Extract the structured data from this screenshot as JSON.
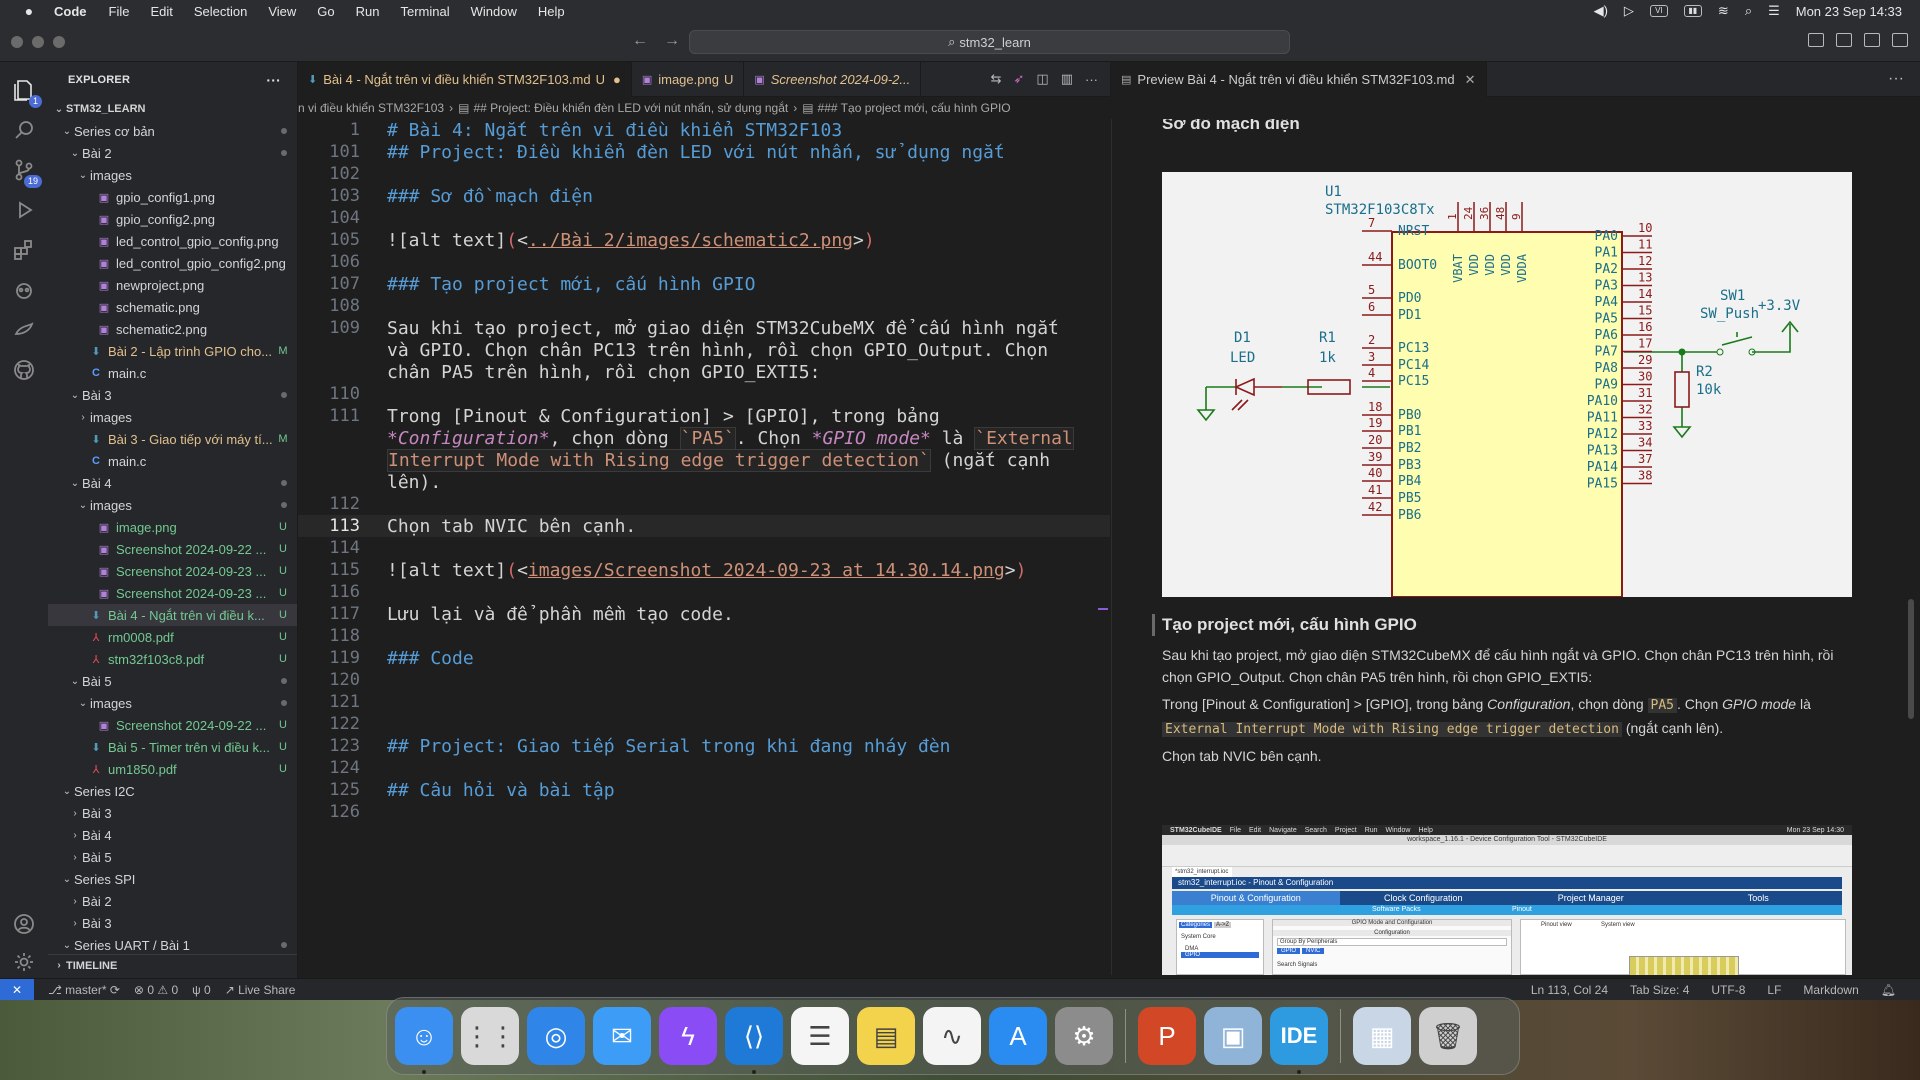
{
  "menubar": {
    "app": "Code",
    "items": [
      "File",
      "Edit",
      "Selection",
      "View",
      "Go",
      "Run",
      "Terminal",
      "Window",
      "Help"
    ],
    "clock": "Mon 23 Sep  14:33",
    "input_source": "VI"
  },
  "titlebar": {
    "search": "stm32_learn"
  },
  "activity": {
    "badge_explorer": "1",
    "badge_scm": "19"
  },
  "explorer": {
    "title": "EXPLORER",
    "root": "STM32_LEARN",
    "rows": [
      {
        "indent": 1,
        "kind": "folder-open",
        "name": "Series cơ bản",
        "status": "dot"
      },
      {
        "indent": 2,
        "kind": "folder-open",
        "name": "Bài 2",
        "status": "dot"
      },
      {
        "indent": 3,
        "kind": "folder-open",
        "name": "images",
        "status": ""
      },
      {
        "indent": 4,
        "kind": "img",
        "name": "gpio_config1.png",
        "status": ""
      },
      {
        "indent": 4,
        "kind": "img",
        "name": "gpio_config2.png",
        "status": ""
      },
      {
        "indent": 4,
        "kind": "img",
        "name": "led_control_gpio_config.png",
        "status": ""
      },
      {
        "indent": 4,
        "kind": "img",
        "name": "led_control_gpio_config2.png",
        "status": ""
      },
      {
        "indent": 4,
        "kind": "img",
        "name": "newproject.png",
        "status": ""
      },
      {
        "indent": 4,
        "kind": "img",
        "name": "schematic.png",
        "status": ""
      },
      {
        "indent": 4,
        "kind": "img",
        "name": "schematic2.png",
        "status": ""
      },
      {
        "indent": 3,
        "kind": "md",
        "name": "Bài 2 - Lập trình GPIO cho...",
        "status": "M"
      },
      {
        "indent": 3,
        "kind": "c",
        "name": "main.c",
        "status": ""
      },
      {
        "indent": 2,
        "kind": "folder-open",
        "name": "Bài 3",
        "status": "dot"
      },
      {
        "indent": 3,
        "kind": "folder",
        "name": "images",
        "status": ""
      },
      {
        "indent": 3,
        "kind": "md",
        "name": "Bài 3 - Giao tiếp với máy tí...",
        "status": "M"
      },
      {
        "indent": 3,
        "kind": "c",
        "name": "main.c",
        "status": ""
      },
      {
        "indent": 2,
        "kind": "folder-open",
        "name": "Bài 4",
        "status": "dot"
      },
      {
        "indent": 3,
        "kind": "folder-open",
        "name": "images",
        "status": "dot"
      },
      {
        "indent": 4,
        "kind": "img",
        "name": "image.png",
        "status": "U"
      },
      {
        "indent": 4,
        "kind": "img",
        "name": "Screenshot 2024-09-22 ...",
        "status": "U"
      },
      {
        "indent": 4,
        "kind": "img",
        "name": "Screenshot 2024-09-23 ...",
        "status": "U"
      },
      {
        "indent": 4,
        "kind": "img",
        "name": "Screenshot 2024-09-23 ...",
        "status": "U"
      },
      {
        "indent": 3,
        "kind": "md",
        "name": "Bài 4 - Ngắt trên vi điều k...",
        "status": "U",
        "selected": true
      },
      {
        "indent": 3,
        "kind": "pdf",
        "name": "rm0008.pdf",
        "status": "U"
      },
      {
        "indent": 3,
        "kind": "pdf",
        "name": "stm32f103c8.pdf",
        "status": "U"
      },
      {
        "indent": 2,
        "kind": "folder-open",
        "name": "Bài 5",
        "status": "dot"
      },
      {
        "indent": 3,
        "kind": "folder-open",
        "name": "images",
        "status": "dot"
      },
      {
        "indent": 4,
        "kind": "img",
        "name": "Screenshot 2024-09-22 ...",
        "status": "U"
      },
      {
        "indent": 3,
        "kind": "md",
        "name": "Bài 5 - Timer trên vi điều k...",
        "status": "U"
      },
      {
        "indent": 3,
        "kind": "pdf",
        "name": "um1850.pdf",
        "status": "U"
      },
      {
        "indent": 1,
        "kind": "folder-open",
        "name": "Series I2C",
        "status": ""
      },
      {
        "indent": 2,
        "kind": "folder",
        "name": "Bài 3",
        "status": ""
      },
      {
        "indent": 2,
        "kind": "folder",
        "name": "Bài 4",
        "status": ""
      },
      {
        "indent": 2,
        "kind": "folder",
        "name": "Bài 5",
        "status": ""
      },
      {
        "indent": 1,
        "kind": "folder-open",
        "name": "Series SPI",
        "status": ""
      },
      {
        "indent": 2,
        "kind": "folder",
        "name": "Bài 2",
        "status": ""
      },
      {
        "indent": 2,
        "kind": "folder",
        "name": "Bài 3",
        "status": ""
      },
      {
        "indent": 1,
        "kind": "folder-open",
        "name": "Series UART / Bài 1",
        "status": "dot"
      }
    ],
    "timeline": "TIMELINE"
  },
  "tabs": {
    "left": [
      {
        "label": "Bài 4 - Ngắt trên vi điều khiển STM32F103.md",
        "status": "U",
        "active": true
      },
      {
        "label": "image.png",
        "status": "U",
        "active": false
      },
      {
        "label": "Screenshot 2024-09-2...",
        "status": "",
        "active": false
      }
    ],
    "right": {
      "label": "Preview Bài 4 - Ngắt trên vi điều khiển STM32F103.md"
    }
  },
  "breadcrumb": {
    "parts": [
      "n vi điều khiển STM32F103",
      "## Project: Điều khiển đèn LED với nút nhấn, sử dụng ngắt",
      "### Tạo project mới, cấu hình GPIO"
    ]
  },
  "editor": {
    "current_line": "113",
    "lines": [
      {
        "n": "1",
        "segs": [
          [
            "h",
            "# Bài 4: Ngắt trên vi điều khiển STM32F103"
          ]
        ]
      },
      {
        "n": "101",
        "segs": [
          [
            "h",
            "## Project: Điều khiển đèn LED với nút nhấn, sử dụng ngắt"
          ]
        ]
      },
      {
        "n": "102",
        "segs": []
      },
      {
        "n": "103",
        "segs": [
          [
            "h",
            "### Sơ đồ mạch điện"
          ]
        ]
      },
      {
        "n": "104",
        "segs": []
      },
      {
        "n": "105",
        "segs": [
          [
            "t",
            "![alt text]"
          ],
          [
            "br",
            "("
          ],
          [
            "t",
            "<"
          ],
          [
            "url",
            "../Bài 2/images/schematic2.png"
          ],
          [
            "t",
            ">"
          ],
          [
            "br",
            ")"
          ]
        ]
      },
      {
        "n": "106",
        "segs": []
      },
      {
        "n": "107",
        "segs": [
          [
            "h",
            "### Tạo project mới, cấu hình GPIO"
          ]
        ]
      },
      {
        "n": "108",
        "segs": []
      },
      {
        "n": "109",
        "segs": [
          [
            "t",
            "Sau khi tạo project, mở giao diện STM32CubeMX để cấu hình ngắt"
          ]
        ]
      },
      {
        "n": "",
        "segs": [
          [
            "t",
            "và GPIO. Chọn chân PC13 trên hình, rồi chọn GPIO_Output. Chọn"
          ]
        ]
      },
      {
        "n": "",
        "segs": [
          [
            "t",
            "chân PA5 trên hình, rồi chọn GPIO_EXTI5:"
          ]
        ]
      },
      {
        "n": "110",
        "segs": []
      },
      {
        "n": "111",
        "segs": [
          [
            "t",
            "Trong [Pinout & Configuration] > [GPIO], trong bảng"
          ]
        ]
      },
      {
        "n": "",
        "segs": [
          [
            "em",
            "*Configuration*"
          ],
          [
            "t",
            ", chọn dòng "
          ],
          [
            "cd",
            "`PA5`"
          ],
          [
            "t",
            ". Chọn "
          ],
          [
            "em",
            "*GPIO mode*"
          ],
          [
            "t",
            " là "
          ],
          [
            "cd",
            "`External"
          ]
        ]
      },
      {
        "n": "",
        "segs": [
          [
            "cd",
            "Interrupt Mode with Rising edge trigger detection`"
          ],
          [
            "t",
            " (ngắt cạnh"
          ]
        ]
      },
      {
        "n": "",
        "segs": [
          [
            "t",
            "lên)."
          ]
        ]
      },
      {
        "n": "112",
        "segs": []
      },
      {
        "n": "113",
        "segs": [
          [
            "t",
            "Chọn tab NVIC bên cạnh."
          ]
        ]
      },
      {
        "n": "114",
        "segs": []
      },
      {
        "n": "115",
        "segs": [
          [
            "t",
            "![alt text]"
          ],
          [
            "br",
            "("
          ],
          [
            "t",
            "<"
          ],
          [
            "url",
            "images/Screenshot 2024-09-23 at 14.30.14.png"
          ],
          [
            "t",
            ">"
          ],
          [
            "br",
            ")"
          ]
        ]
      },
      {
        "n": "116",
        "segs": []
      },
      {
        "n": "117",
        "segs": [
          [
            "t",
            "Lưu lại và để phần mềm tạo code."
          ]
        ]
      },
      {
        "n": "118",
        "segs": []
      },
      {
        "n": "119",
        "segs": [
          [
            "h",
            "### Code"
          ]
        ]
      },
      {
        "n": "120",
        "segs": []
      },
      {
        "n": "121",
        "segs": []
      },
      {
        "n": "122",
        "segs": []
      },
      {
        "n": "123",
        "segs": [
          [
            "h",
            "## Project: Giao tiếp Serial trong khi đang nháy đèn"
          ]
        ]
      },
      {
        "n": "124",
        "segs": []
      },
      {
        "n": "125",
        "segs": [
          [
            "h",
            "## Câu hỏi và bài tập"
          ]
        ]
      },
      {
        "n": "126",
        "segs": []
      }
    ]
  },
  "preview": {
    "h_schematic": "Sơ đồ mạch điện",
    "h_project": "Tạo project mới, cấu hình GPIO",
    "p1": "Sau khi tạo project, mở giao diện STM32CubeMX để cấu hình ngắt và GPIO. Chọn chân PC13 trên hình, rồi chọn GPIO_Output. Chọn chân PA5 trên hình, rồi chọn GPIO_EXTI5:",
    "p2_a": "Trong [Pinout & Configuration] > [GPIO], trong bảng ",
    "p2_em1": "Configuration",
    "p2_b": ", chọn dòng ",
    "p2_code1": "PA5",
    "p2_c": ". Chọn ",
    "p2_em2": "GPIO mode",
    "p2_d": " là ",
    "p2_code2": "External Interrupt Mode with Rising edge trigger detection",
    "p2_e": " (ngắt cạnh lên).",
    "p3": "Chọn tab NVIC bên cạnh.",
    "schematic": {
      "u1": "U1",
      "part": "STM32F103C8Tx",
      "left_pins": [
        [
          "7",
          "NRST"
        ],
        [
          "44",
          "BOOT0"
        ],
        [
          "5",
          "PD0"
        ],
        [
          "6",
          "PD1"
        ],
        [
          "2",
          "PC13"
        ],
        [
          "3",
          "PC14"
        ],
        [
          "4",
          "PC15"
        ],
        [
          "18",
          "PB0"
        ],
        [
          "19",
          "PB1"
        ],
        [
          "20",
          "PB2"
        ],
        [
          "39",
          "PB3"
        ],
        [
          "40",
          "PB4"
        ],
        [
          "41",
          "PB5"
        ],
        [
          "42",
          "PB6"
        ]
      ],
      "right_pins": [
        [
          "10",
          "PA0"
        ],
        [
          "11",
          "PA1"
        ],
        [
          "12",
          "PA2"
        ],
        [
          "13",
          "PA3"
        ],
        [
          "14",
          "PA4"
        ],
        [
          "15",
          "PA5"
        ],
        [
          "16",
          "PA6"
        ],
        [
          "17",
          "PA7"
        ],
        [
          "29",
          "PA8"
        ],
        [
          "30",
          "PA9"
        ],
        [
          "31",
          "PA10"
        ],
        [
          "32",
          "PA11"
        ],
        [
          "33",
          "PA12"
        ],
        [
          "34",
          "PA13"
        ],
        [
          "37",
          "PA14"
        ],
        [
          "38",
          "PA15"
        ]
      ],
      "top_pins": [
        [
          "1",
          "VBAT"
        ],
        [
          "24",
          "VDD"
        ],
        [
          "36",
          "VDD"
        ],
        [
          "48",
          "VDD"
        ],
        [
          "9",
          "VDDA"
        ]
      ],
      "d1": "D1",
      "led": "LED",
      "r1": "R1",
      "r1v": "1k",
      "sw1": "SW1",
      "swp": "SW_Push",
      "vcc": "+3.3V",
      "r2": "R2",
      "r2v": "10k"
    },
    "shot": {
      "app": "STM32CubeIDE",
      "menus": [
        "File",
        "Edit",
        "Navigate",
        "Search",
        "Project",
        "Run",
        "Window",
        "Help"
      ],
      "time": "Mon 23 Sep 14:30",
      "title": "workspace_1.16.1 - Device Configuration Tool - STM32CubeIDE",
      "file_tab": "*stm32_interrupt.ioc",
      "crumb": "stm32_interrupt.ioc - Pinout & Configuration",
      "tabs": [
        "Pinout & Configuration",
        "Clock Configuration",
        "Project Manager",
        "Tools"
      ],
      "sub1": "Software Packs",
      "sub2": "Pinout",
      "categories": "Categories",
      "az": "A->Z",
      "system_core": "System Core",
      "items": [
        "DMA",
        "GPIO"
      ],
      "mode_title": "GPIO Mode and Configuration",
      "config": "Configuration",
      "group": "Group By Peripherals",
      "gtabs": [
        "GPIO",
        "NVIC"
      ],
      "search": "Search Signals",
      "pinout_view": "Pinout view",
      "system_view": "System view"
    }
  },
  "status": {
    "branch": "master*",
    "errors": "0",
    "warnings": "0",
    "ports": "0",
    "liveshare": "Live Share",
    "position": "Ln 113, Col 24",
    "tabsize": "Tab Size: 4",
    "encoding": "UTF-8",
    "eol": "LF",
    "language": "Markdown"
  },
  "dock": {
    "apps": [
      {
        "name": "finder",
        "glyph": "☺",
        "bg": "#3b8ff0",
        "running": true
      },
      {
        "name": "launchpad",
        "glyph": "⋮⋮",
        "bg": "#d9d9d9",
        "running": false
      },
      {
        "name": "safari",
        "glyph": "◎",
        "bg": "#2f86e8",
        "running": false
      },
      {
        "name": "mail",
        "glyph": "✉",
        "bg": "#3d9cf5",
        "running": false
      },
      {
        "name": "messenger",
        "glyph": "ϟ",
        "bg": "#8a4cf5",
        "running": false
      },
      {
        "name": "vscode",
        "glyph": "⟨⟩",
        "bg": "#1e7ad6",
        "running": true
      },
      {
        "name": "reminders",
        "glyph": "☰",
        "bg": "#f5f5f5",
        "running": false
      },
      {
        "name": "notes",
        "glyph": "▤",
        "bg": "#f3d24c",
        "running": false
      },
      {
        "name": "freeform",
        "glyph": "∿",
        "bg": "#f4f4f4",
        "running": false
      },
      {
        "name": "app-store",
        "glyph": "A",
        "bg": "#2a8cf0",
        "running": false
      },
      {
        "name": "system-settings",
        "glyph": "⚙",
        "bg": "#8c8c8c",
        "running": false
      },
      {
        "sep": true
      },
      {
        "name": "powerpoint",
        "glyph": "P",
        "bg": "#d24726",
        "running": false
      },
      {
        "name": "preview",
        "glyph": "▣",
        "bg": "#8fb4d8",
        "running": false
      },
      {
        "name": "stm32cubeide",
        "glyph": "IDE",
        "bg": "#2e9be0",
        "running": true
      },
      {
        "sep": true
      },
      {
        "name": "documents",
        "glyph": "▦",
        "bg": "#c9d6e6",
        "running": false
      },
      {
        "name": "trash",
        "glyph": "🗑",
        "bg": "#cfcfcf",
        "running": false
      }
    ]
  }
}
